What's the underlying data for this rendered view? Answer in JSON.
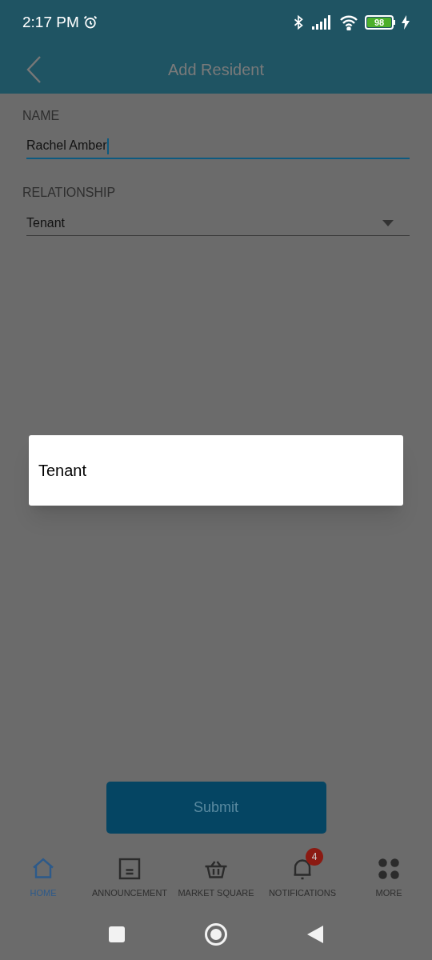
{
  "status_bar": {
    "time": "2:17 PM",
    "battery": "98"
  },
  "app_bar": {
    "title": "Add Resident"
  },
  "form": {
    "fields": [
      {
        "label": "NAME",
        "value": "Rachel Amber",
        "focused": true,
        "kind": "text"
      },
      {
        "label": "RELATIONSHIP",
        "value": "Tenant",
        "focused": false,
        "kind": "dropdown"
      }
    ]
  },
  "dropdown_menu": {
    "options": [
      "Tenant"
    ]
  },
  "submit_button": "Submit",
  "bottom_nav": [
    {
      "label": "HOME",
      "kind": "home",
      "selected": true
    },
    {
      "label": "ANNOUNCEMENT",
      "kind": "announcement",
      "selected": false
    },
    {
      "label": "MARKET SQUARE",
      "kind": "basket",
      "selected": false
    },
    {
      "label": "NOTIFICATIONS",
      "kind": "bell",
      "selected": false,
      "badge": "4"
    },
    {
      "label": "MORE",
      "kind": "grid",
      "selected": false
    }
  ]
}
